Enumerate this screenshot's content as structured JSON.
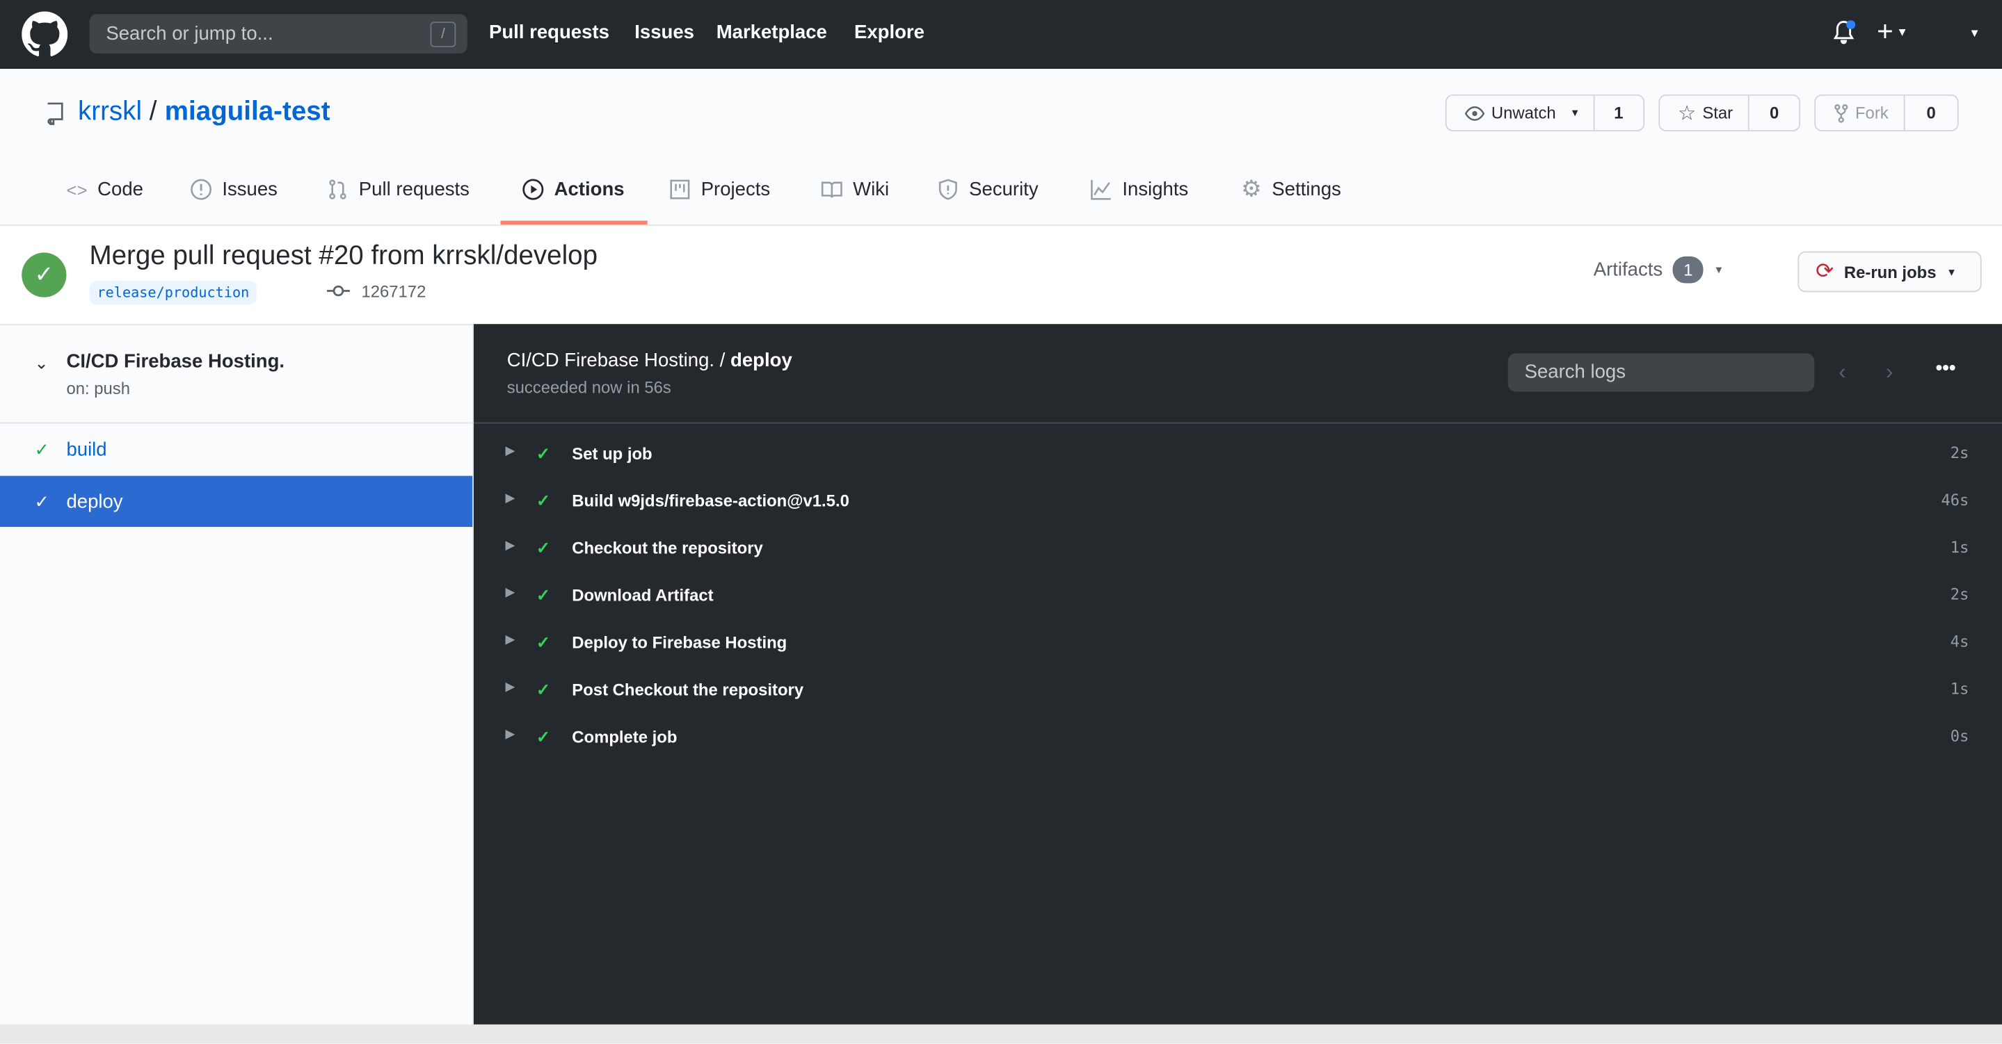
{
  "topnav": {
    "search_placeholder": "Search or jump to...",
    "slash_key": "/",
    "links": [
      "Pull requests",
      "Issues",
      "Marketplace",
      "Explore"
    ]
  },
  "repo": {
    "owner": "krrskl",
    "separator": "/",
    "name": "miaguila-test",
    "watch": {
      "label": "Unwatch",
      "count": "1"
    },
    "star": {
      "label": "Star",
      "count": "0"
    },
    "fork": {
      "label": "Fork",
      "count": "0"
    }
  },
  "tabs": [
    {
      "label": "Code"
    },
    {
      "label": "Issues"
    },
    {
      "label": "Pull requests"
    },
    {
      "label": "Actions",
      "active": true
    },
    {
      "label": "Projects"
    },
    {
      "label": "Wiki"
    },
    {
      "label": "Security"
    },
    {
      "label": "Insights"
    },
    {
      "label": "Settings"
    }
  ],
  "run": {
    "title": "Merge pull request #20 from krrskl/develop",
    "branch": "release/production",
    "commit": "1267172",
    "status": "success",
    "artifacts_label": "Artifacts",
    "artifacts_count": "1",
    "rerun_label": "Re-run jobs"
  },
  "sidebar": {
    "workflow": "CI/CD Firebase Hosting.",
    "trigger": "on: push",
    "jobs": [
      {
        "name": "build",
        "selected": false
      },
      {
        "name": "deploy",
        "selected": true
      }
    ]
  },
  "job": {
    "workflow": "CI/CD Firebase Hosting.",
    "separator": " / ",
    "name": "deploy",
    "status": "succeeded now in 56s",
    "search_placeholder": "Search logs",
    "steps": [
      {
        "name": "Set up job",
        "time": "2s"
      },
      {
        "name": "Build w9jds/firebase-action@v1.5.0",
        "time": "46s"
      },
      {
        "name": "Checkout the repository",
        "time": "1s"
      },
      {
        "name": "Download Artifact",
        "time": "2s"
      },
      {
        "name": "Deploy to Firebase Hosting",
        "time": "4s"
      },
      {
        "name": "Post Checkout the repository",
        "time": "1s"
      },
      {
        "name": "Complete job",
        "time": "0s"
      }
    ]
  },
  "colors": {
    "accent": "#0366d6",
    "success": "#28a745",
    "tab_underline": "#f9826c",
    "header_bg": "#24292e"
  }
}
